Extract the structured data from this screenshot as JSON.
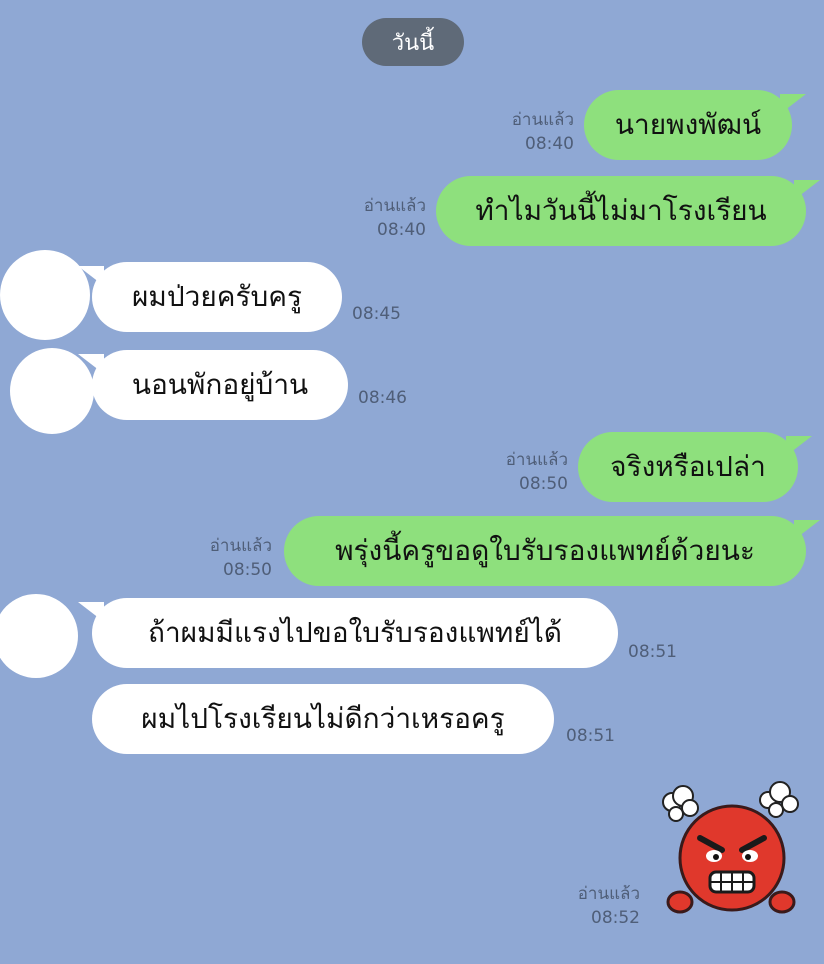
{
  "date_label": "วันนี้",
  "colors": {
    "background": "#8fa8d4",
    "outgoing_bubble": "#8ee07d",
    "incoming_bubble": "#ffffff",
    "date_pill": "#5f6a78"
  },
  "messages": [
    {
      "direction": "out",
      "text": "นายพงพัฒน์",
      "read": "อ่านแล้ว",
      "time": "08:40"
    },
    {
      "direction": "out",
      "text": "ทำไมวันนี้ไม่มาโรงเรียน",
      "read": "อ่านแล้ว",
      "time": "08:40"
    },
    {
      "direction": "in",
      "text": "ผมป่วยครับครู",
      "time": "08:45"
    },
    {
      "direction": "in",
      "text": "นอนพักอยู่บ้าน",
      "time": "08:46"
    },
    {
      "direction": "out",
      "text": "จริงหรือเปล่า",
      "read": "อ่านแล้ว",
      "time": "08:50"
    },
    {
      "direction": "out",
      "text": "พรุ่งนี้ครูขอดูใบรับรองแพทย์ด้วยนะ",
      "read": "อ่านแล้ว",
      "time": "08:50"
    },
    {
      "direction": "in",
      "text": "ถ้าผมมีแรงไปขอใบรับรองแพทย์ได้",
      "time": "08:51"
    },
    {
      "direction": "in",
      "text": "ผมไปโรงเรียนไม่ดีกว่าเหรอครู",
      "time": "08:51"
    }
  ],
  "sticker": {
    "name": "angry-red-face-sticker",
    "read": "อ่านแล้ว",
    "time": "08:52"
  }
}
